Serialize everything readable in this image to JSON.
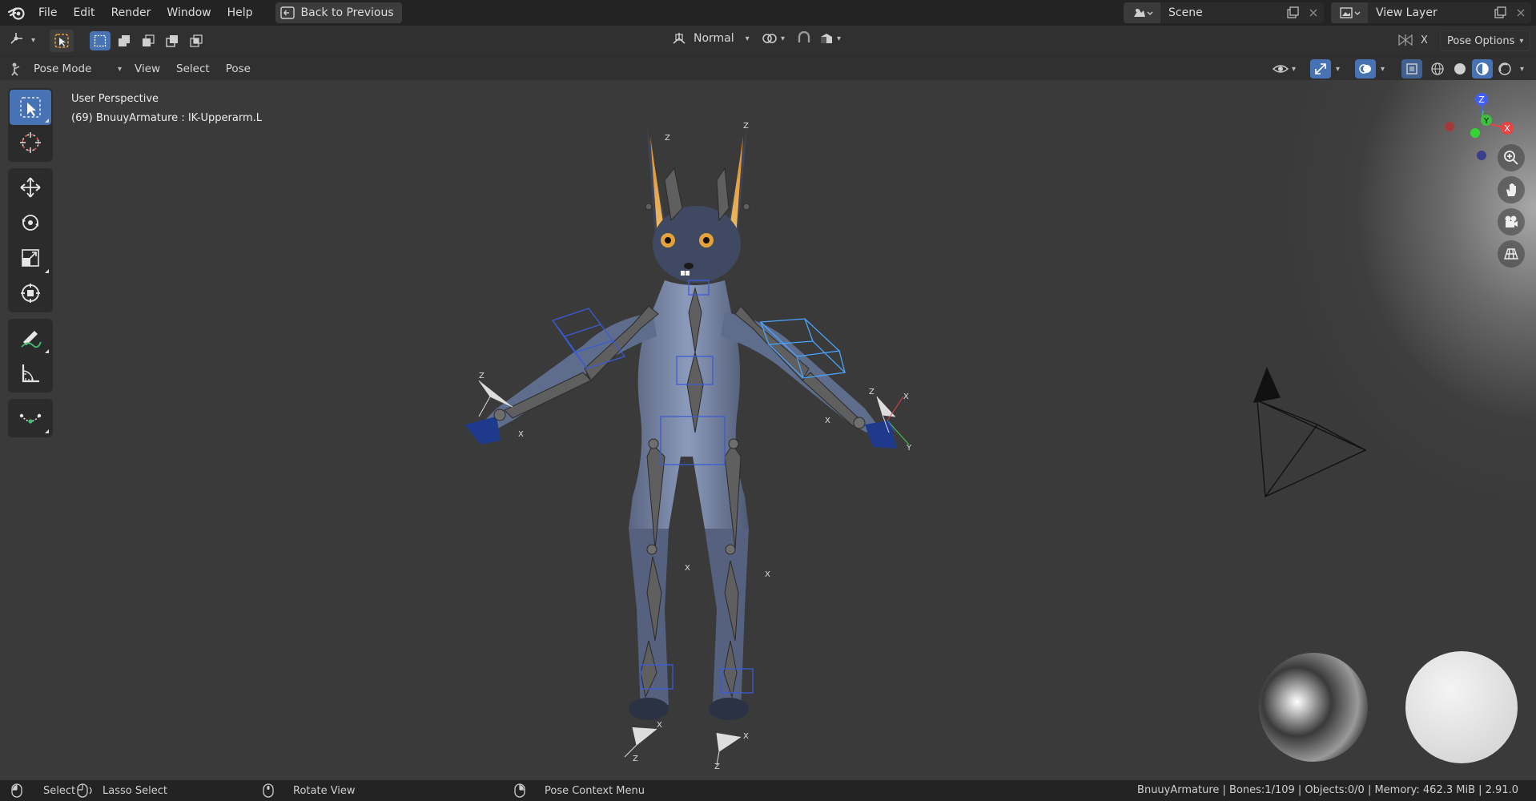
{
  "menu": {
    "items": [
      "File",
      "Edit",
      "Render",
      "Window",
      "Help"
    ],
    "back_button": "Back to Previous"
  },
  "scene": {
    "name": "Scene"
  },
  "view_layer": {
    "name": "View Layer"
  },
  "tool_header": {
    "orientation": "Normal",
    "pose_options": "Pose Options",
    "x_label": "X"
  },
  "mode_header": {
    "mode": "Pose Mode",
    "menus": [
      "View",
      "Select",
      "Pose"
    ]
  },
  "viewport": {
    "perspective": "User Perspective",
    "active_object": "(69) BnuuyArmature : IK-Upperarm.L",
    "gizmo_axes": {
      "x": "X",
      "y": "Y",
      "z": "Z"
    }
  },
  "status": {
    "select": "Select",
    "lasso": "Lasso Select",
    "rotate": "Rotate View",
    "context": "Pose Context Menu",
    "info": "BnuuyArmature | Bones:1/109 | Objects:0/0 | Memory: 462.3 MiB | 2.91.0"
  },
  "colors": {
    "accent": "#4772b3",
    "header": "#303030",
    "viewport": "#3a3a3a",
    "axis_x": "#e84444",
    "axis_y": "#3fbf3f",
    "axis_z": "#3f5fff",
    "character_body": "#7a8aa8",
    "bone_gray": "#5f5f5f",
    "widget_blue": "#4aa3ff"
  }
}
